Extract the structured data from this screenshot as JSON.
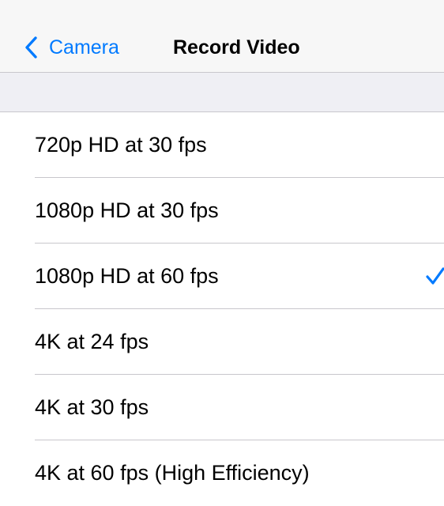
{
  "colors": {
    "accent": "#007aff",
    "nav_background": "#f7f7f7",
    "group_background": "#efeff4",
    "separator": "#c8c7cc"
  },
  "nav": {
    "back_icon": "chevron-left-icon",
    "back_label": "Camera",
    "title": "Record Video"
  },
  "options": [
    {
      "label": "720p HD at 30 fps",
      "selected": false
    },
    {
      "label": "1080p HD at 30 fps",
      "selected": false
    },
    {
      "label": "1080p HD at 60 fps",
      "selected": true
    },
    {
      "label": "4K at 24 fps",
      "selected": false
    },
    {
      "label": "4K at 30 fps",
      "selected": false
    },
    {
      "label": "4K at 60 fps (High Efficiency)",
      "selected": false
    }
  ],
  "selected_icon": "checkmark-icon"
}
